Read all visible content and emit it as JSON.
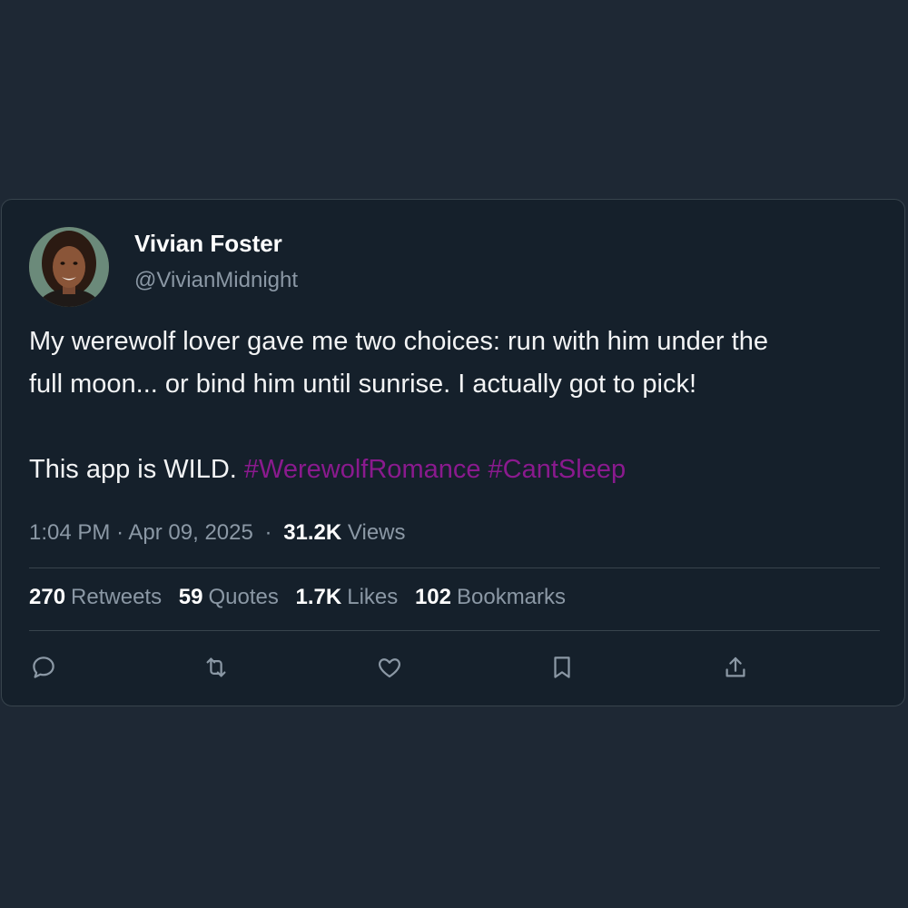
{
  "author": {
    "display_name": "Vivian Foster",
    "handle": "@VivianMidnight"
  },
  "tweet": {
    "line1": "My werewolf lover gave me two choices: run with him under the",
    "line2": "full moon... or bind him until sunrise. I actually got to pick!",
    "line3_text": "This app is WILD.",
    "hashtags": [
      "#WerewolfRomance",
      "#CantSleep"
    ]
  },
  "meta": {
    "time": "1:04 PM",
    "separator": "·",
    "date": "Apr 09, 2025",
    "views_count": "31.2K",
    "views_label": "Views"
  },
  "stats": [
    {
      "count": "270",
      "label": "Retweets"
    },
    {
      "count": "59",
      "label": "Quotes"
    },
    {
      "count": "1.7K",
      "label": "Likes"
    },
    {
      "count": "102",
      "label": "Bookmarks"
    }
  ],
  "actions": [
    {
      "icon": "reply-icon"
    },
    {
      "icon": "retweet-icon"
    },
    {
      "icon": "like-icon"
    },
    {
      "icon": "bookmark-icon"
    },
    {
      "icon": "share-icon"
    }
  ],
  "colors": {
    "background": "#1e2834",
    "card": "#15202b",
    "hashtag": "#8a1a8e",
    "muted": "#8b98a5"
  }
}
